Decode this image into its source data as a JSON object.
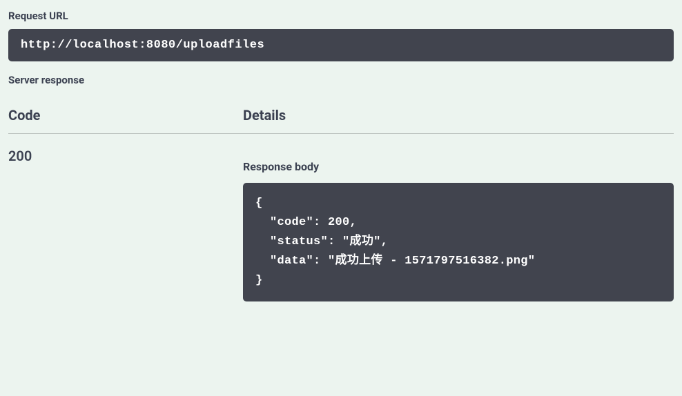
{
  "request": {
    "urlLabel": "Request URL",
    "url": "http://localhost:8080/uploadfiles"
  },
  "serverResponse": {
    "label": "Server response",
    "codeHeader": "Code",
    "detailsHeader": "Details",
    "codeValue": "200",
    "responseBodyLabel": "Response body",
    "responseBodyText": "{\n  \"code\": 200,\n  \"status\": \"成功\",\n  \"data\": \"成功上传 - 1571797516382.png\"\n}"
  }
}
